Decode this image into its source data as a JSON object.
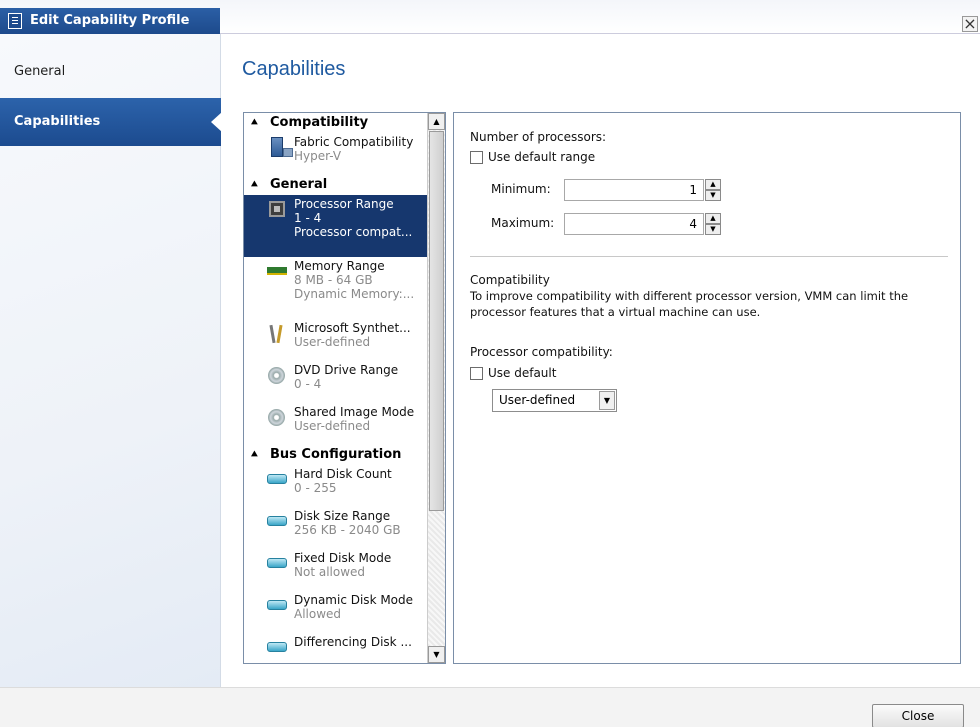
{
  "window": {
    "title": "Edit Capability Profile",
    "close_glyph": "×"
  },
  "nav": {
    "items": [
      {
        "label": "General"
      },
      {
        "label": "Capabilities"
      }
    ]
  },
  "page_title": "Capabilities",
  "list": {
    "groups": [
      {
        "label": "Compatibility",
        "items": [
          {
            "icon": "server-icon",
            "name": "Fabric Compatibility",
            "sub": [
              "Hyper-V"
            ]
          }
        ]
      },
      {
        "label": "General",
        "items": [
          {
            "icon": "processor-icon",
            "name": "Processor Range",
            "sub": [
              "1 - 4",
              "Processor compat..."
            ],
            "selected": true
          },
          {
            "icon": "memory-icon",
            "name": "Memory Range",
            "sub": [
              "8 MB - 64  GB",
              "Dynamic Memory:..."
            ]
          },
          {
            "icon": "tools-icon",
            "name": "Microsoft Synthet...",
            "sub": [
              "User-defined"
            ]
          },
          {
            "icon": "dvd-icon",
            "name": "DVD Drive Range",
            "sub": [
              "0 - 4"
            ]
          },
          {
            "icon": "image-icon",
            "name": "Shared Image Mode",
            "sub": [
              "User-defined"
            ]
          }
        ]
      },
      {
        "label": "Bus Configuration",
        "items": [
          {
            "icon": "hard-disk-icon",
            "name": "Hard Disk Count",
            "sub": [
              "0 - 255"
            ]
          },
          {
            "icon": "hard-disk-icon",
            "name": "Disk Size Range",
            "sub": [
              "256 KB - 2040  GB"
            ]
          },
          {
            "icon": "hard-disk-icon",
            "name": "Fixed Disk Mode",
            "sub": [
              "Not allowed"
            ]
          },
          {
            "icon": "hard-disk-icon",
            "name": "Dynamic Disk Mode",
            "sub": [
              "Allowed"
            ]
          },
          {
            "icon": "hard-disk-icon",
            "name": "Differencing Disk ...",
            "sub": [
              ""
            ]
          }
        ]
      }
    ]
  },
  "detail": {
    "num_processors_label": "Number of processors:",
    "use_default_range_label": "Use default range",
    "minimum_label": "Minimum:",
    "minimum_value": "1",
    "maximum_label": "Maximum:",
    "maximum_value": "4",
    "compat_heading": "Compatibility",
    "compat_desc_1": "To improve compatibility with different processor version, VMM can limit the",
    "compat_desc_2": "processor features that a virtual machine can use.",
    "processor_compat_label": "Processor compatibility:",
    "use_default_label": "Use default",
    "compat_select_value": "User-defined"
  },
  "footer": {
    "close_label": "Close"
  }
}
